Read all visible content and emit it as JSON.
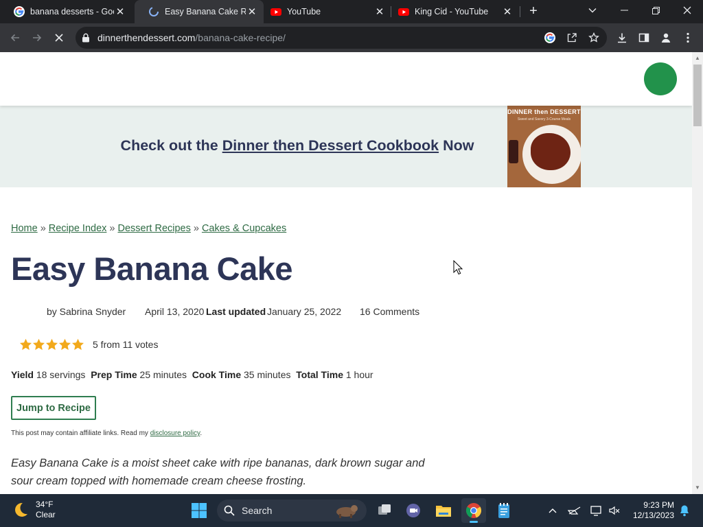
{
  "browser": {
    "tabs": [
      {
        "title": "banana desserts - Google Search",
        "icon": "google-icon"
      },
      {
        "title": "Easy Banana Cake Recipe",
        "icon": "loading-spinner-icon",
        "active": true
      },
      {
        "title": "YouTube",
        "icon": "youtube-icon"
      },
      {
        "title": "King Cid - YouTube",
        "icon": "youtube-icon"
      }
    ],
    "url_host": "dinnerthendessert.com",
    "url_path": "/banana-cake-recipe/"
  },
  "page": {
    "promo": {
      "prefix": "Check out the",
      "link": "Dinner then Dessert Cookbook",
      "suffix": "Now",
      "book_title": "DINNER then DESSERT",
      "book_subtitle": "Sweet and Savory 3-Course Meals"
    },
    "breadcrumbs": [
      "Home",
      "Recipe Index",
      "Dessert Recipes",
      "Cakes & Cupcakes"
    ],
    "breadcrumb_separator": "»",
    "title": "Easy Banana Cake",
    "meta": {
      "author": "by Sabrina Snyder",
      "date": "April 13, 2020",
      "updated_label": "Last updated",
      "updated_date": "January 25, 2022",
      "comments": "16 Comments"
    },
    "rating": {
      "value": 5,
      "max": 5,
      "text": "5 from 11 votes"
    },
    "times": {
      "yield_label": "Yield",
      "yield_value": "18 servings",
      "prep_label": "Prep Time",
      "prep_value": "25 minutes",
      "cook_label": "Cook Time",
      "cook_value": "35 minutes",
      "total_label": "Total Time",
      "total_value": "1 hour"
    },
    "jump_button": "Jump to Recipe",
    "affiliate_prefix": "This post may contain affiliate links. Read my",
    "affiliate_link": "disclosure policy",
    "affiliate_suffix": ".",
    "intro": "Easy Banana Cake is a moist sheet cake with ripe bananas, dark brown sugar and sour cream topped with homemade cream cheese frosting."
  },
  "taskbar": {
    "weather_temp": "34°F",
    "weather_desc": "Clear",
    "search_label": "Search",
    "time": "9:23 PM",
    "date": "12/13/2023"
  },
  "colors": {
    "title": "#2d3557",
    "link_green": "#2e6a43",
    "accent_green": "#22924b",
    "star": "#f2a91b",
    "promo_bg": "#e9f0ee"
  }
}
